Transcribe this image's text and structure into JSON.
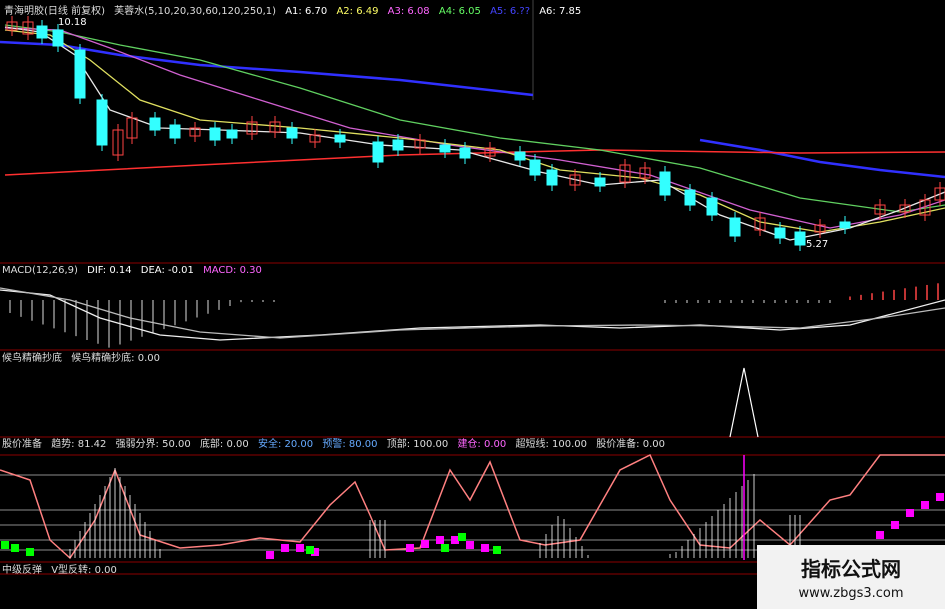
{
  "main_header": {
    "symbol": "青海明胶(日线 前复权)",
    "indicator": "芙蓉水(5,10,20,30,60,120,250,1)",
    "a1": "A1: 6.70",
    "a2": "A2: 6.49",
    "a3": "A3: 6.08",
    "a4": "A4: 6.05",
    "a5": "A5: 6.??",
    "a6": "A6: 7.85"
  },
  "price_labels": {
    "high": "10.18",
    "low": "5.27"
  },
  "macd_header": {
    "name": "MACD(12,26,9)",
    "dif": "DIF: 0.14",
    "dea": "DEA: -0.01",
    "macd": "MACD: 0.30"
  },
  "bird_header": {
    "name": "候鸟精确抄底",
    "value": "候鸟精确抄底: 0.00"
  },
  "stock_header": {
    "name": "股价准备",
    "trend": "趋势: 81.42",
    "strong_weak": "强弱分界: 50.00",
    "bottom": "底部: 0.00",
    "safe": "安全: 20.00",
    "warn": "预警: 80.00",
    "top": "顶部: 100.00",
    "build": "建仓: 0.00",
    "super_short": "超短线: 100.00",
    "stock_prep": "股价准备: 0.00"
  },
  "bottom_header": {
    "name": "中级反弹",
    "v_reversal": "V型反转: 0.00"
  },
  "watermark": {
    "title": "指标公式网",
    "url": "www.zbgs3.com"
  },
  "colors": {
    "up_candle": "#ff4444",
    "down_candle": "#33ffff",
    "ma_white": "#e8e8e8",
    "ma_yellow": "#e0e060",
    "ma_purple": "#d060d0",
    "ma_green": "#60d060",
    "ma_blue": "#3030ff",
    "ma_red": "#ff3030",
    "separator": "#8b0000",
    "trend_line": "#ff8080",
    "magenta": "#ff00ff",
    "green_block": "#00ff00"
  }
}
